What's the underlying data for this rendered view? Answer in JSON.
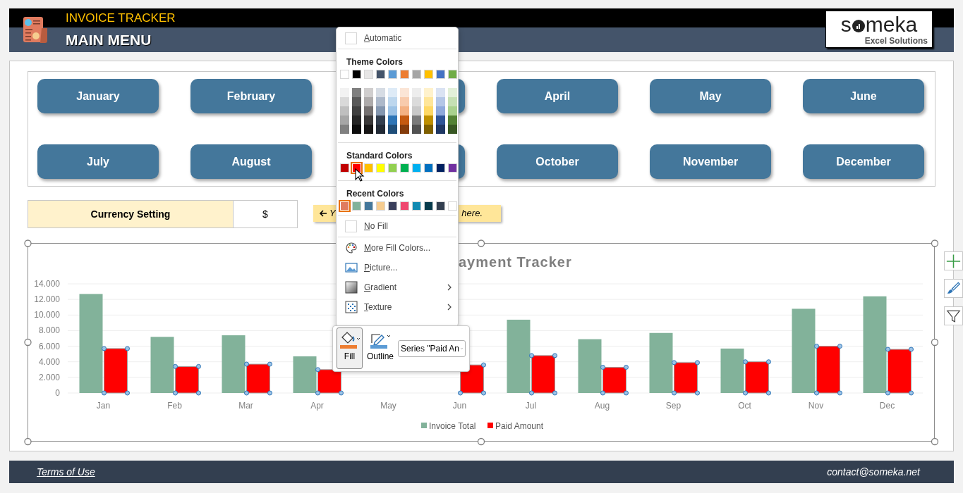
{
  "header": {
    "app_title": "INVOICE TRACKER",
    "page_title": "MAIN MENU"
  },
  "logo": {
    "before": "s",
    "after": "meka",
    "tagline": "Excel Solutions"
  },
  "months": [
    {
      "kind": "labeled",
      "label": "January"
    },
    {
      "kind": "labeled",
      "label": "February"
    },
    {
      "kind": "covered"
    },
    {
      "kind": "labeled",
      "label": "April"
    },
    {
      "kind": "labeled",
      "label": "May"
    },
    {
      "kind": "labeled",
      "label": "June"
    },
    {
      "kind": "labeled",
      "label": "July"
    },
    {
      "kind": "labeled",
      "label": "August"
    },
    {
      "kind": "covered"
    },
    {
      "kind": "labeled",
      "label": "October"
    },
    {
      "kind": "labeled",
      "label": "November"
    },
    {
      "kind": "labeled",
      "label": "December"
    }
  ],
  "currency": {
    "label": "Currency Setting",
    "value": "$"
  },
  "note": {
    "start": "Y",
    "end": "here."
  },
  "chart": {
    "chart_data": {
      "type": "bar",
      "title": "ayment Tracker",
      "categories": [
        "Jan",
        "Feb",
        "Mar",
        "Apr",
        "May",
        "Jun",
        "Jul",
        "Aug",
        "Sep",
        "Oct",
        "Nov",
        "Dec"
      ],
      "series": [
        {
          "name": "Invoice Total",
          "color": "#82b29a",
          "values": [
            12700,
            7200,
            7400,
            4700,
            null,
            null,
            9400,
            6900,
            7700,
            5700,
            10800,
            12400
          ]
        },
        {
          "name": "Paid Amount",
          "color": "#ff0000",
          "values": [
            5700,
            3400,
            3700,
            3000,
            null,
            3600,
            4800,
            3300,
            3900,
            4000,
            6000,
            5600
          ]
        }
      ],
      "ylim": [
        0,
        14000
      ],
      "grid": true,
      "legend": "bottom",
      "yticks": [
        {
          "value": 0,
          "label": "0"
        },
        {
          "value": 2000,
          "label": "2.000"
        },
        {
          "value": 4000,
          "label": "4.000"
        },
        {
          "value": 6000,
          "label": "6.000"
        },
        {
          "value": 8000,
          "label": "8.000"
        },
        {
          "value": 10000,
          "label": "10.000"
        },
        {
          "value": 12000,
          "label": "12.000"
        },
        {
          "value": 14000,
          "label": "14.000"
        }
      ]
    }
  },
  "footer": {
    "left": "Terms of Use",
    "right": "contact@someka.net"
  },
  "fill_menu": {
    "automatic": "Automatic",
    "theme_title": "Theme Colors",
    "theme_colors": [
      {
        "color": "#ffffff",
        "selected": false
      },
      {
        "color": "#000000",
        "selected": false
      },
      {
        "color": "#e7e6e6",
        "selected": false
      },
      {
        "color": "#44546a",
        "selected": false
      },
      {
        "color": "#5b9bd5",
        "selected": false
      },
      {
        "color": "#ed7d31",
        "selected": false
      },
      {
        "color": "#a5a5a5",
        "selected": false
      },
      {
        "color": "#ffc000",
        "selected": false
      },
      {
        "color": "#4472c4",
        "selected": false
      },
      {
        "color": "#70ad47",
        "selected": false
      }
    ],
    "theme_shades": [
      [
        {
          "color": "#f2f2f2",
          "selected": false
        },
        {
          "color": "#d9d9d9",
          "selected": false
        },
        {
          "color": "#bfbfbf",
          "selected": false
        },
        {
          "color": "#a6a6a6",
          "selected": false
        },
        {
          "color": "#808080",
          "selected": false
        }
      ],
      [
        {
          "color": "#7f7f7f",
          "selected": false
        },
        {
          "color": "#595959",
          "selected": false
        },
        {
          "color": "#404040",
          "selected": false
        },
        {
          "color": "#262626",
          "selected": false
        },
        {
          "color": "#0d0d0d",
          "selected": false
        }
      ],
      [
        {
          "color": "#d0cece",
          "selected": false
        },
        {
          "color": "#aeabab",
          "selected": false
        },
        {
          "color": "#757171",
          "selected": false
        },
        {
          "color": "#3a3838",
          "selected": false
        },
        {
          "color": "#171616",
          "selected": false
        }
      ],
      [
        {
          "color": "#d6dce4",
          "selected": false
        },
        {
          "color": "#adb9ca",
          "selected": false
        },
        {
          "color": "#8497b0",
          "selected": false
        },
        {
          "color": "#333f4f",
          "selected": false
        },
        {
          "color": "#222a35",
          "selected": false
        }
      ],
      [
        {
          "color": "#deebf7",
          "selected": false
        },
        {
          "color": "#bdd7ee",
          "selected": false
        },
        {
          "color": "#9dc3e6",
          "selected": false
        },
        {
          "color": "#2e75b6",
          "selected": false
        },
        {
          "color": "#1f4e79",
          "selected": false
        }
      ],
      [
        {
          "color": "#fbe5d6",
          "selected": false
        },
        {
          "color": "#f8cbad",
          "selected": false
        },
        {
          "color": "#f4b183",
          "selected": false
        },
        {
          "color": "#c55a11",
          "selected": false
        },
        {
          "color": "#843c0c",
          "selected": false
        }
      ],
      [
        {
          "color": "#ededed",
          "selected": false
        },
        {
          "color": "#dbdbdb",
          "selected": false
        },
        {
          "color": "#c9c9c9",
          "selected": false
        },
        {
          "color": "#7b7b7b",
          "selected": false
        },
        {
          "color": "#525252",
          "selected": false
        }
      ],
      [
        {
          "color": "#fff2cc",
          "selected": false
        },
        {
          "color": "#ffe699",
          "selected": false
        },
        {
          "color": "#ffd966",
          "selected": false
        },
        {
          "color": "#bf9000",
          "selected": false
        },
        {
          "color": "#7f6000",
          "selected": false
        }
      ],
      [
        {
          "color": "#dae3f3",
          "selected": false
        },
        {
          "color": "#b4c7e7",
          "selected": false
        },
        {
          "color": "#8faadc",
          "selected": false
        },
        {
          "color": "#2f5597",
          "selected": false
        },
        {
          "color": "#203864",
          "selected": false
        }
      ],
      [
        {
          "color": "#e2f0d9",
          "selected": false
        },
        {
          "color": "#c5e0b4",
          "selected": false
        },
        {
          "color": "#a9d18e",
          "selected": false
        },
        {
          "color": "#548235",
          "selected": false
        },
        {
          "color": "#385723",
          "selected": false
        }
      ]
    ],
    "standard_title": "Standard Colors",
    "standard_colors": [
      {
        "color": "#c00000",
        "selected": false
      },
      {
        "color": "#ff0000",
        "selected": true
      },
      {
        "color": "#ffc000",
        "selected": false
      },
      {
        "color": "#ffff00",
        "selected": false
      },
      {
        "color": "#92d050",
        "selected": false
      },
      {
        "color": "#00b050",
        "selected": false
      },
      {
        "color": "#00b0f0",
        "selected": false
      },
      {
        "color": "#0070c0",
        "selected": false
      },
      {
        "color": "#002060",
        "selected": false
      },
      {
        "color": "#7030a0",
        "selected": false
      }
    ],
    "recent_title": "Recent Colors",
    "recent_colors": [
      {
        "color": "#e07b5f",
        "selected": true
      },
      {
        "color": "#82b29a",
        "selected": false
      },
      {
        "color": "#44779b",
        "selected": false
      },
      {
        "color": "#f6cc8f",
        "selected": false
      },
      {
        "color": "#3a3f5c",
        "selected": false
      },
      {
        "color": "#ef476f",
        "selected": false
      },
      {
        "color": "#118ab2",
        "selected": false
      },
      {
        "color": "#073b4c",
        "selected": false
      },
      {
        "color": "#333f50",
        "selected": false
      },
      {
        "color": "#ffffff",
        "selected": false
      }
    ],
    "no_fill": "No Fill",
    "items": [
      {
        "kind": "more_colors",
        "label": "More Fill Colors...",
        "submenu": false
      },
      {
        "kind": "picture",
        "label": "Picture...",
        "submenu": false
      },
      {
        "kind": "gradient",
        "label": "Gradient",
        "submenu": true
      },
      {
        "kind": "texture",
        "label": "Texture",
        "submenu": true
      }
    ]
  },
  "mini_toolbar": {
    "fill": {
      "label": "Fill",
      "pressed": true
    },
    "outline": {
      "label": "Outline",
      "pressed": false
    },
    "series_select": "Series \"Paid An"
  }
}
